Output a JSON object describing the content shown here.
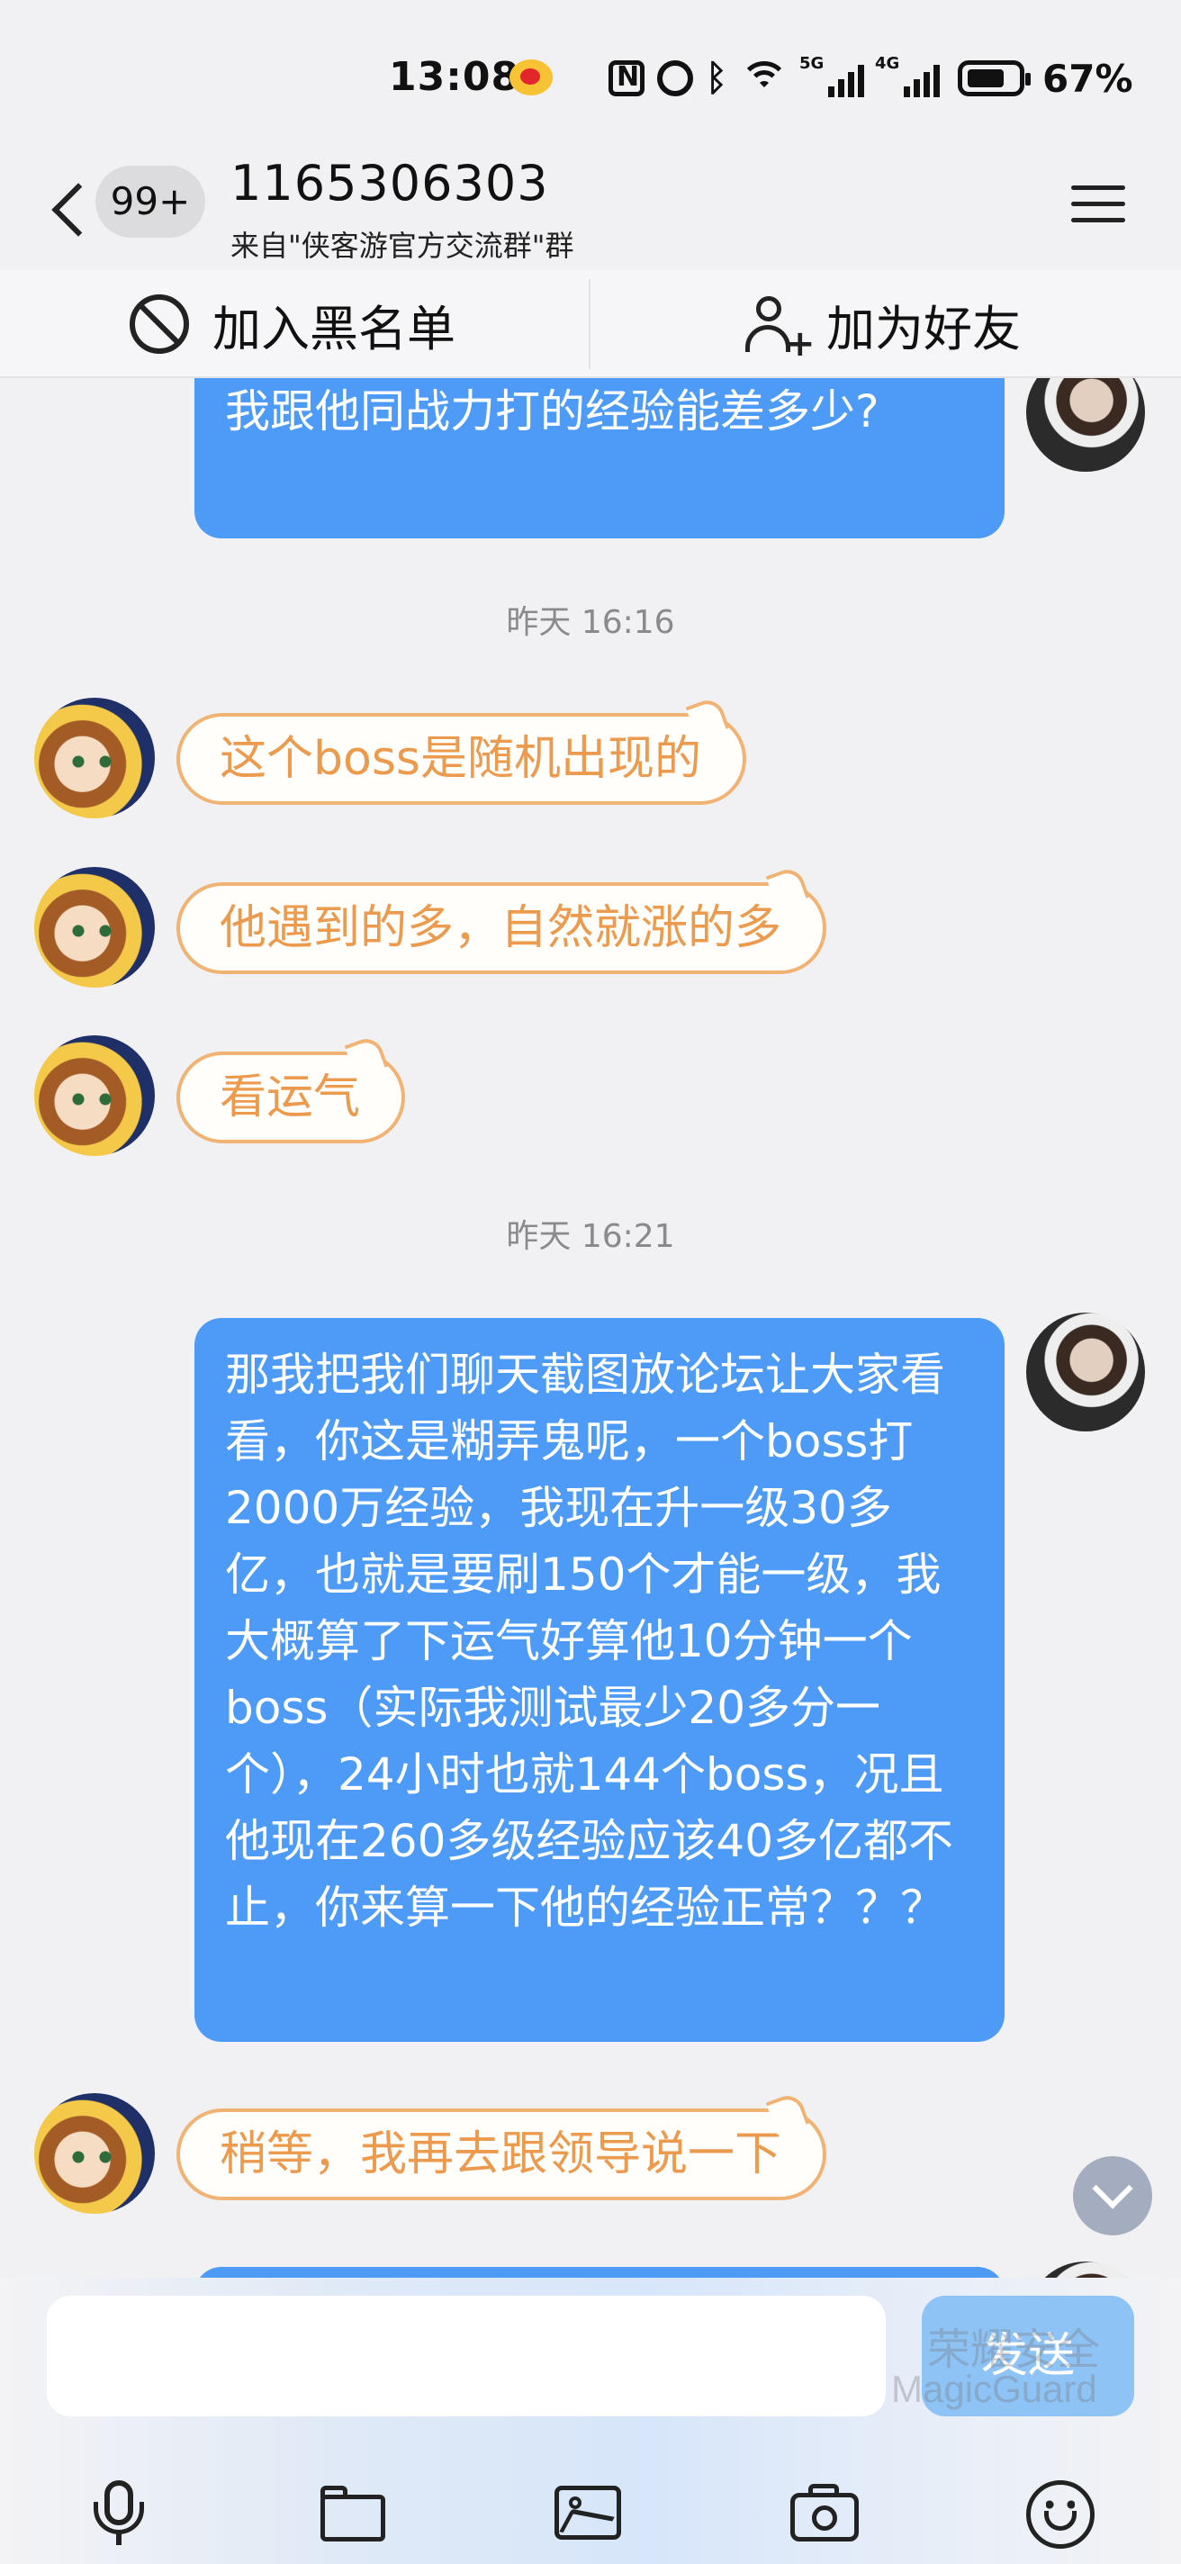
{
  "status_bar": {
    "time": "13:08",
    "network_1": "5G",
    "network_2": "4G",
    "battery": "67%"
  },
  "header": {
    "unread_badge": "99+",
    "title": "1165306303",
    "subtitle": "来自\"侠客游官方交流群\"群"
  },
  "actions": {
    "block_label": "加入黑名单",
    "add_friend_label": "加为好友"
  },
  "messages": [
    {
      "type": "self",
      "text": "我跟他同战力打的经验能差多少?"
    },
    {
      "type": "time",
      "text": "昨天 16:16"
    },
    {
      "type": "other",
      "text": "这个boss是随机出现的"
    },
    {
      "type": "other",
      "text": "他遇到的多，自然就涨的多"
    },
    {
      "type": "other",
      "text": "看运气"
    },
    {
      "type": "time",
      "text": "昨天 16:21"
    },
    {
      "type": "self",
      "text": "那我把我们聊天截图放论坛让大家看看，你这是糊弄鬼呢，一个boss打2000万经验，我现在升一级30多亿，也就是要刷150个才能一级，我大概算了下运气好算他10分钟一个boss（实际我测试最少20多分一个），24小时也就144个boss，况且他现在260多级经验应该40多亿都不止，你来算一下他的经验正常？？？"
    },
    {
      "type": "other",
      "text": "稍等，我再去跟领导说一下"
    }
  ],
  "input": {
    "placeholder": "",
    "send_label": "发送",
    "watermark_line1": "荣耀安全",
    "watermark_line2": "MagicGuard"
  },
  "icons": {
    "toolbar": [
      "mic-icon",
      "folder-icon",
      "image-icon",
      "camera-icon",
      "emoji-icon"
    ]
  },
  "colors": {
    "self_bubble": "#4d9bf7",
    "other_bubble_border": "#f1b374",
    "other_bubble_text": "#eb9a4e",
    "send_button": "#8ec3f5"
  }
}
